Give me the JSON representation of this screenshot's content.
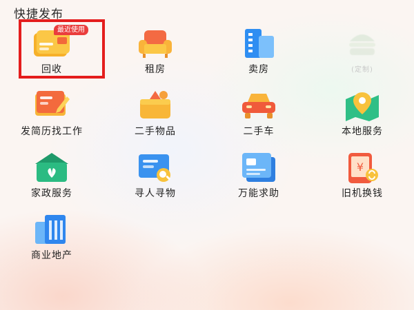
{
  "section": {
    "title": "快捷发布"
  },
  "recent_badge": "最近使用",
  "colors": {
    "highlight": "#e41d1d",
    "badge": "#ea3d3d"
  },
  "items": [
    {
      "label": "回收",
      "icon": "card-icon"
    },
    {
      "label": "租房",
      "icon": "sofa-icon"
    },
    {
      "label": "卖房",
      "icon": "building-icon"
    },
    {
      "label": "(定制)",
      "icon": "burger-icon"
    },
    {
      "label": "发简历找工作",
      "icon": "resume-pen-icon"
    },
    {
      "label": "二手物品",
      "icon": "box-icon"
    },
    {
      "label": "二手车",
      "icon": "car-icon"
    },
    {
      "label": "本地服务",
      "icon": "map-pin-icon"
    },
    {
      "label": "家政服务",
      "icon": "house-leaf-icon"
    },
    {
      "label": "寻人寻物",
      "icon": "search-card-icon"
    },
    {
      "label": "万能求助",
      "icon": "document-icon"
    },
    {
      "label": "旧机换钱",
      "icon": "phone-yuan-icon"
    },
    {
      "label": "商业地产",
      "icon": "commercial-building-icon"
    }
  ]
}
